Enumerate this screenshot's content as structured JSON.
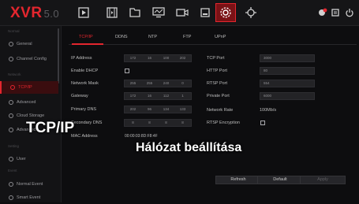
{
  "app": {
    "logo": "XVR",
    "version": "5.0"
  },
  "toolbar_icons": [
    "playback-icon",
    "video-file-icon",
    "folder-icon",
    "monitor-icon",
    "camera-icon",
    "backup-icon",
    "settings-icon",
    "network-icon"
  ],
  "toolbar_right_icons": [
    "alarm-icon",
    "notification-icon",
    "power-icon"
  ],
  "sidebar": {
    "sections": [
      "Normal",
      "Network",
      "Setting",
      "Event"
    ],
    "items": [
      {
        "label": "General",
        "icon": "gear-icon"
      },
      {
        "label": "Channel Config",
        "icon": "channel-icon"
      },
      {
        "label": "TCP/IP",
        "icon": "network-icon"
      },
      {
        "label": "Advanced",
        "icon": "advanced-icon"
      },
      {
        "label": "Cloud Storage",
        "icon": "cloud-icon"
      },
      {
        "label": "Advanced",
        "icon": "advanced-icon"
      },
      {
        "label": "User",
        "icon": "user-icon"
      },
      {
        "label": "Normal Event",
        "icon": "event-icon"
      },
      {
        "label": "Smart Event",
        "icon": "smart-event-icon"
      }
    ]
  },
  "tabs": [
    "TCP/IP",
    "DDNS",
    "NTP",
    "FTP",
    "UPnP"
  ],
  "form": {
    "ip_address": {
      "label": "IP Address",
      "value": [
        "172",
        "16",
        "100",
        "202"
      ]
    },
    "dhcp": {
      "label": "Enable DHCP",
      "checked": false
    },
    "netmask": {
      "label": "Network Mask",
      "value": [
        "255",
        "255",
        "240",
        "0"
      ]
    },
    "gateway": {
      "label": "Gateway",
      "value": [
        "172",
        "16",
        "112",
        "1"
      ]
    },
    "dns1": {
      "label": "Primary DNS",
      "value": [
        "202",
        "96",
        "134",
        "133"
      ]
    },
    "dns2": {
      "label": "Secondary DNS",
      "value": [
        "8",
        "8",
        "8",
        "8"
      ]
    },
    "mac": {
      "label": "MAC Address",
      "value": "00:00:03:8D:F8:4F"
    },
    "tcp_port": {
      "label": "TCP Port",
      "value": "3000"
    },
    "http_port": {
      "label": "HTTP Port",
      "value": "80"
    },
    "rtsp_port": {
      "label": "RTSP Port",
      "value": "554"
    },
    "private_port": {
      "label": "Private Port",
      "value": "6000"
    },
    "network_rate": {
      "label": "Network Rate",
      "value": "100Mb/s"
    },
    "rtsp_encryption": {
      "label": "RTSP Encryption",
      "checked": false
    }
  },
  "buttons": {
    "refresh": "Refresh",
    "default": "Default",
    "apply": "Apply"
  },
  "overlay": {
    "tcpip": "TCP/IP",
    "caption": "Hálózat beállítása"
  },
  "colors": {
    "accent": "#e3262e",
    "background": "#0d0d0f",
    "panel": "#151517"
  }
}
